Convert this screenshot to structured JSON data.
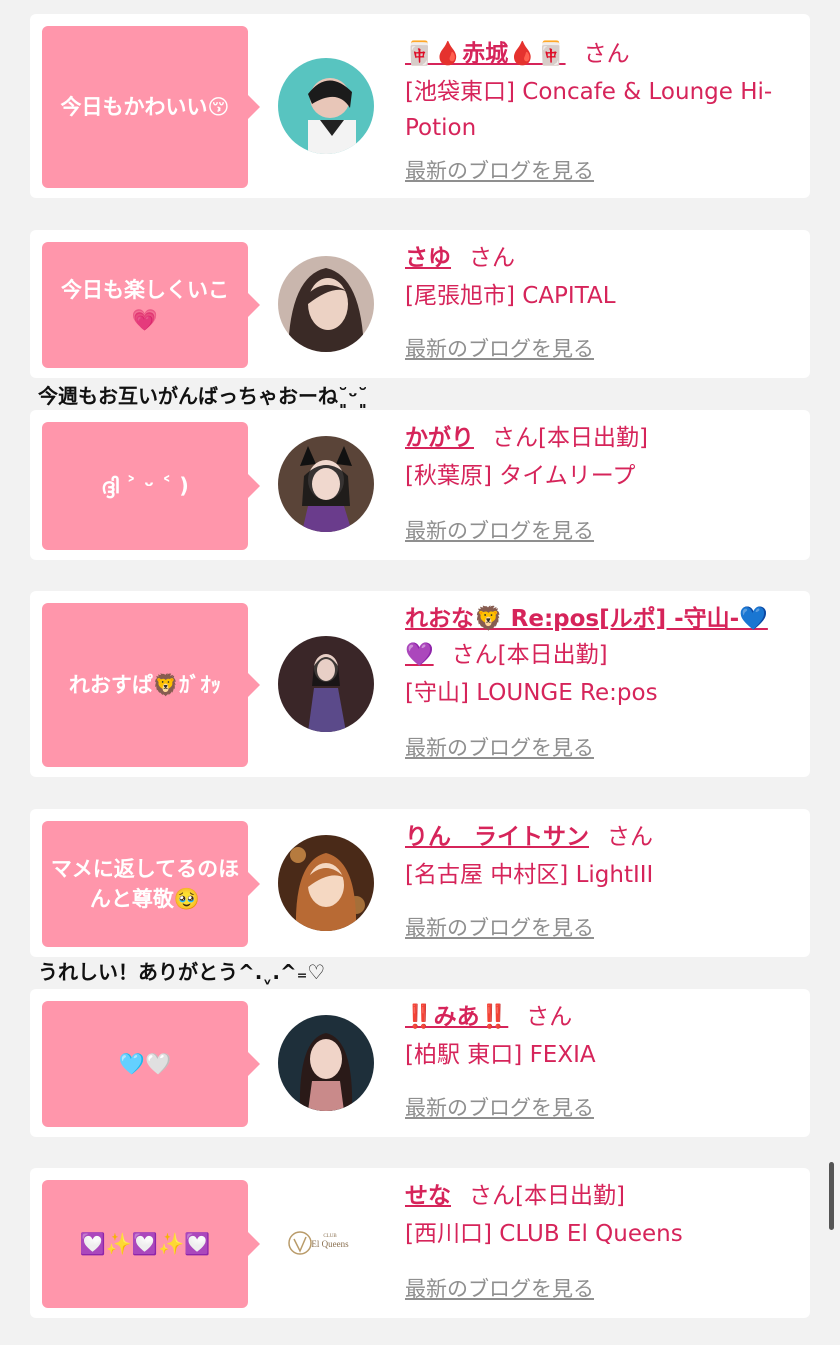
{
  "blog_link_label": "最新のブログを見る",
  "san_label": "さん",
  "messages_between": [
    "今週もお互いがんばっちゃおーね˘͈ᵕ˘͈",
    "うれしい！ありがとう^.ˬ.^₌♡"
  ],
  "cards": [
    {
      "bubble": "今日もかわいい😚",
      "name": "🀄🩸赤城🩸🀄",
      "status": "",
      "shop": "[池袋東口] Concafe & Lounge Hi-Potion"
    },
    {
      "bubble": "今日も楽しくいこ💗",
      "name": "さゆ",
      "status": "",
      "shop": "[尾張旭市] CAPITAL"
    },
    {
      "bubble": "ദ്ദി ˃ ᵕ ˂ )",
      "name": "かがり",
      "status": "[本日出勤]",
      "shop": "[秋葉原] タイムリープ"
    },
    {
      "bubble": "れおすぱ🦁ｶﾞｵｯ",
      "name": "れおな🦁 Re:pos[ルポ] -守山-💙💜",
      "status": "[本日出勤]",
      "shop": "[守山] LOUNGE Re:pos"
    },
    {
      "bubble": "マメに返してるのほんと尊敬🥹",
      "name": "りん　ライトサン",
      "status": "",
      "shop": "[名古屋 中村区] LightIII"
    },
    {
      "bubble": "🩵🤍",
      "name": "‼️みあ‼️",
      "status": "",
      "shop": "[柏駅 東口] FEXIA"
    },
    {
      "bubble": "💟✨💟✨💟",
      "name": "せな",
      "status": "[本日出勤]",
      "shop": "[西川口] CLUB El Queens"
    }
  ],
  "logo_text": {
    "club": "CLUB",
    "brand": "El Queens"
  },
  "colors": {
    "accent": "#d6245a",
    "bubble": "#ff96ab",
    "background": "#f2f2f2"
  }
}
